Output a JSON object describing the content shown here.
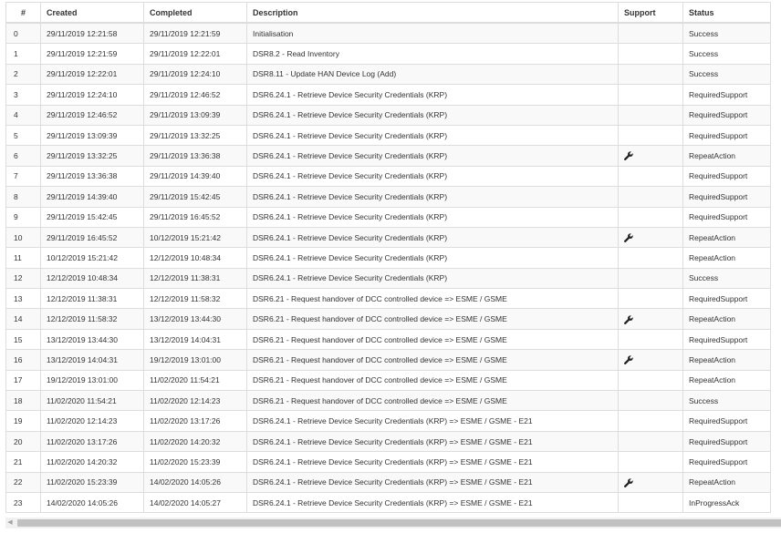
{
  "table": {
    "headers": {
      "num": "#",
      "created": "Created",
      "completed": "Completed",
      "description": "Description",
      "support": "Support",
      "status": "Status"
    },
    "rows": [
      {
        "num": "0",
        "created": "29/11/2019 12:21:58",
        "completed": "29/11/2019 12:21:59",
        "description": "Initialisation",
        "support": false,
        "status": "Success"
      },
      {
        "num": "1",
        "created": "29/11/2019 12:21:59",
        "completed": "29/11/2019 12:22:01",
        "description": "DSR8.2 - Read Inventory",
        "support": false,
        "status": "Success"
      },
      {
        "num": "2",
        "created": "29/11/2019 12:22:01",
        "completed": "29/11/2019 12:24:10",
        "description": "DSR8.11 - Update HAN Device Log (Add)",
        "support": false,
        "status": "Success"
      },
      {
        "num": "3",
        "created": "29/11/2019 12:24:10",
        "completed": "29/11/2019 12:46:52",
        "description": "DSR6.24.1 - Retrieve Device Security Credentials (KRP)",
        "support": false,
        "status": "RequiredSupport"
      },
      {
        "num": "4",
        "created": "29/11/2019 12:46:52",
        "completed": "29/11/2019 13:09:39",
        "description": "DSR6.24.1 - Retrieve Device Security Credentials (KRP)",
        "support": false,
        "status": "RequiredSupport"
      },
      {
        "num": "5",
        "created": "29/11/2019 13:09:39",
        "completed": "29/11/2019 13:32:25",
        "description": "DSR6.24.1 - Retrieve Device Security Credentials (KRP)",
        "support": false,
        "status": "RequiredSupport"
      },
      {
        "num": "6",
        "created": "29/11/2019 13:32:25",
        "completed": "29/11/2019 13:36:38",
        "description": "DSR6.24.1 - Retrieve Device Security Credentials (KRP)",
        "support": true,
        "status": "RepeatAction"
      },
      {
        "num": "7",
        "created": "29/11/2019 13:36:38",
        "completed": "29/11/2019 14:39:40",
        "description": "DSR6.24.1 - Retrieve Device Security Credentials (KRP)",
        "support": false,
        "status": "RequiredSupport"
      },
      {
        "num": "8",
        "created": "29/11/2019 14:39:40",
        "completed": "29/11/2019 15:42:45",
        "description": "DSR6.24.1 - Retrieve Device Security Credentials (KRP)",
        "support": false,
        "status": "RequiredSupport"
      },
      {
        "num": "9",
        "created": "29/11/2019 15:42:45",
        "completed": "29/11/2019 16:45:52",
        "description": "DSR6.24.1 - Retrieve Device Security Credentials (KRP)",
        "support": false,
        "status": "RequiredSupport"
      },
      {
        "num": "10",
        "created": "29/11/2019 16:45:52",
        "completed": "10/12/2019 15:21:42",
        "description": "DSR6.24.1 - Retrieve Device Security Credentials (KRP)",
        "support": true,
        "status": "RepeatAction"
      },
      {
        "num": "11",
        "created": "10/12/2019 15:21:42",
        "completed": "12/12/2019 10:48:34",
        "description": "DSR6.24.1 - Retrieve Device Security Credentials (KRP)",
        "support": false,
        "status": "RepeatAction"
      },
      {
        "num": "12",
        "created": "12/12/2019 10:48:34",
        "completed": "12/12/2019 11:38:31",
        "description": "DSR6.24.1 - Retrieve Device Security Credentials (KRP)",
        "support": false,
        "status": "Success"
      },
      {
        "num": "13",
        "created": "12/12/2019 11:38:31",
        "completed": "12/12/2019 11:58:32",
        "description": "DSR6.21 - Request handover of DCC controlled device => ESME / GSME",
        "support": false,
        "status": "RequiredSupport"
      },
      {
        "num": "14",
        "created": "12/12/2019 11:58:32",
        "completed": "13/12/2019 13:44:30",
        "description": "DSR6.21 - Request handover of DCC controlled device => ESME / GSME",
        "support": true,
        "status": "RepeatAction"
      },
      {
        "num": "15",
        "created": "13/12/2019 13:44:30",
        "completed": "13/12/2019 14:04:31",
        "description": "DSR6.21 - Request handover of DCC controlled device => ESME / GSME",
        "support": false,
        "status": "RequiredSupport"
      },
      {
        "num": "16",
        "created": "13/12/2019 14:04:31",
        "completed": "19/12/2019 13:01:00",
        "description": "DSR6.21 - Request handover of DCC controlled device => ESME / GSME",
        "support": true,
        "status": "RepeatAction"
      },
      {
        "num": "17",
        "created": "19/12/2019 13:01:00",
        "completed": "11/02/2020 11:54:21",
        "description": "DSR6.21 - Request handover of DCC controlled device => ESME / GSME",
        "support": false,
        "status": "RepeatAction"
      },
      {
        "num": "18",
        "created": "11/02/2020 11:54:21",
        "completed": "11/02/2020 12:14:23",
        "description": "DSR6.21 - Request handover of DCC controlled device => ESME / GSME",
        "support": false,
        "status": "Success"
      },
      {
        "num": "19",
        "created": "11/02/2020 12:14:23",
        "completed": "11/02/2020 13:17:26",
        "description": "DSR6.24.1 - Retrieve Device Security Credentials (KRP) => ESME / GSME - E21",
        "support": false,
        "status": "RequiredSupport"
      },
      {
        "num": "20",
        "created": "11/02/2020 13:17:26",
        "completed": "11/02/2020 14:20:32",
        "description": "DSR6.24.1 - Retrieve Device Security Credentials (KRP) => ESME / GSME - E21",
        "support": false,
        "status": "RequiredSupport"
      },
      {
        "num": "21",
        "created": "11/02/2020 14:20:32",
        "completed": "11/02/2020 15:23:39",
        "description": "DSR6.24.1 - Retrieve Device Security Credentials (KRP) => ESME / GSME - E21",
        "support": false,
        "status": "RequiredSupport"
      },
      {
        "num": "22",
        "created": "11/02/2020 15:23:39",
        "completed": "14/02/2020 14:05:26",
        "description": "DSR6.24.1 - Retrieve Device Security Credentials (KRP) => ESME / GSME - E21",
        "support": true,
        "status": "RepeatAction"
      },
      {
        "num": "23",
        "created": "14/02/2020 14:05:26",
        "completed": "14/02/2020 14:05:27",
        "description": "DSR6.24.1 - Retrieve Device Security Credentials (KRP) => ESME / GSME - E21",
        "support": false,
        "status": "InProgressAck"
      }
    ]
  },
  "icons": {
    "support": "wrench-icon",
    "scroll_left": "scroll-left-arrow-icon"
  },
  "colors": {
    "text": "#333333",
    "border": "#dddddd",
    "stripe": "#f9f9f9"
  }
}
